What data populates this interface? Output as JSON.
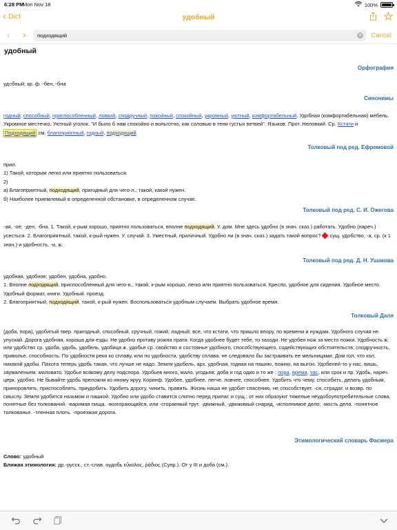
{
  "status": {
    "time": "6:28 PM",
    "date": "Mon Nov 18",
    "battery_text": "100%",
    "battery_level": 1.0
  },
  "nav": {
    "back_label": "Dict",
    "title": "удобный",
    "icons": [
      "share-icon",
      "star-icon"
    ]
  },
  "search": {
    "value": "подходящий",
    "cancel_label": "Cancel"
  },
  "entry": {
    "headword": "удобный",
    "orthography": {
      "heading": "Орфография",
      "text_before": "уд",
      "stressed": "о",
      "text_after": "бный; кр. ф. -бен, -бна"
    },
    "synonyms": {
      "heading": "Синонимы",
      "s1": "годный",
      "s2": "способный",
      "s3": "приспособленный",
      "s4": "ловкий",
      "s5": "сподручный",
      "s6": "покойный",
      "s7": "спокойный",
      "s8": "укромный",
      "s9": "уютный",
      "s10": "комфортабельный",
      "t1": ", ",
      "t_tail": ". Удобная (комфортабельная) мебель. Укромное местечко. Уютный уголок. \"И было б нам спокойно и вольготно, как соловью в тени густых ветвей\". Языков. Прот. Неловкий. Ср. ",
      "kstati": "Кстати",
      "and": " и ",
      "podhodyashchiy": "Подходящий",
      "see": " см. ",
      "see1": "благоприятный",
      "see2": "годный",
      "see3": "подходящий"
    },
    "efremova": {
      "heading": "Толковый под ред. Ефремовой",
      "l1": "прил.",
      "l2": "1) Такой, которым легко или приятно пользоваться.",
      "l3": "2)",
      "l4a": "а) Благоприятный, ",
      "l4hl": "подходящий",
      "l4b": ", пригодный для чего-л.; такой, какой нужен.",
      "l5": "б) Наиболее приемлемый в определенной обстановке, в определенном случае."
    },
    "ozhegov": {
      "heading": "Толковый под ред. С. И. Ожегова",
      "a": "-ая, -ое; -ден, -бна. 1. Такой, к-рым хорошо, приятно пользоваться, вполне ",
      "hl": "подходящий",
      "b": ". У. дом. Мне здесь удобно (в знач. сказ.) работать. Удобно (нареч.) усесться. 2. Благоприятный, такой, к-рый нужен. У. случай. 3. Уместный, приличный. Удобно ли (в знач. сказ.) задать такой вопрос?",
      "c": "сущ. удобство, -а, ср. (к 1 знач.) и удобность, -и, ж."
    },
    "ushakov": {
      "heading": "Толковый под ред. Д. Н. Ушакова",
      "l1": "удобная, удобное; удобен, удобна, удобно.",
      "l2a": "1. Вполне ",
      "l2hl": "подходящий",
      "l2b": ", приспособленный для чего-н., такой, к-рым хорошо, легко или приятно пользоваться. Кресло, удобное для сидения. Удобное место. Удобный формат, книги. Удобный. проезд.",
      "l3a": "2. Благоприятный, ",
      "l3hl": "подходящий",
      "l3b": ", такой, к-рый нужен. Воспользоваться удобным случаем. Выбрать удобное время."
    },
    "dal": {
      "heading": "Толковый Даля",
      "a": "(доба, пора), удобитый твер. пригодный, способный, сручный, гожий, ладный; все, что кстати, что пришло впору, по времени и нуждам. Удобного случая не упускай. Дорога удобная, хороша для езды. Не удобно противу рожна прати. Когда удобнее будет тебе, то заходи. Не удобен нож за место ложки. Удобность ж. или удобство ср. удоба, удобь, удобель, удобица ж. удобье ср. свойство и состоянье удобного, способствующего, содействующих обстоятельств; сподручность, привольe, способность. По удобности реки ко сплаву, или по удобности, удобству сплава. не следовало бы застраивать ее мельницами. Дом гол, что кол, никакой удобы. Пахота теперь удобь такая, что лучше не надо. Земля удобель, арх. удобная, годная на пашню, пожню, на выгон. Удобелей-то у нас, вишь, заумаленьем. маловато. Удобье всякому делу подспора. Удобьев много, мало, угодьев; доба и год одио и то же : ",
      "link1": "пора",
      "sep1": ", ",
      "link2": "время",
      "sep2": ", ",
      "link3": "час",
      "b": ", или срок и пр. Удобь, нареч. церк. удобно. Не бывайте удобь преложни ко иному яруу, Коринф. Удобее, удобнее, легче, ловчее, способнее. Удобить что чему, способить, делать удобным, приноровлять, приспособлять, приудобить. Удобить дорогу, чинить, править. Жизнь наша не удобит спасению, не способствует. -ся, страдат. и возвр. по смыслу. Земля удобится назьмом и пашкой. Удобно или удобо ставится слитно перед прилаг. и сущ.; от них образуют тяжелые неудобоупотребительные слова, понятные без толкований. -варимая пища. -возгорающийся, или -сгораемый трут. -движный, -движимый снаряд, -исполнимое дело; -мость дела. -понятное толкованье. -тленная плоть. -проезжая дорога."
    },
    "fasmer": {
      "heading": "Этимологический словарь Фасмера",
      "word_label": "Слово:",
      "word": "удобный",
      "etym_label": "Ближая этимология:",
      "etym": "др.-русск., ст.-слав. оудобь εὔκολος, ῥᾴδιος (Супр.). От у III и доба (см.)."
    }
  },
  "toolbar": {
    "icons": [
      "undo-icon",
      "redo-icon",
      "copy-icon",
      "chevron-down-icon"
    ]
  },
  "colors": {
    "accent": "#f0a81c",
    "heading": "#2e6da1",
    "link": "#1f4fd6",
    "highlight": "#fbf3c2",
    "stress": "#d62323"
  }
}
